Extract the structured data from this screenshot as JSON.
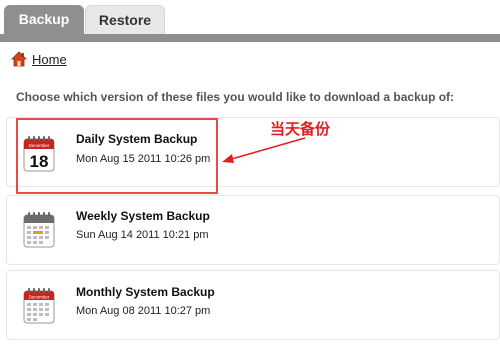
{
  "tabs": [
    {
      "label": "Backup",
      "active": true
    },
    {
      "label": "Restore",
      "active": false
    }
  ],
  "breadcrumb": {
    "home_label": "Home",
    "icon": "home-icon"
  },
  "instruction": "Choose which version of these files you would like to download a backup of:",
  "backups": [
    {
      "title": "Daily System Backup",
      "date": "Mon Aug 15 2011 10:26 pm",
      "icon": "calendar-day-icon",
      "calendar_month": "December",
      "calendar_day": "18"
    },
    {
      "title": "Weekly System Backup",
      "date": "Sun Aug 14 2011 10:21 pm",
      "icon": "calendar-week-icon"
    },
    {
      "title": "Monthly System Backup",
      "date": "Mon Aug 08 2011 10:27 pm",
      "icon": "calendar-month-icon",
      "calendar_month": "December"
    }
  ],
  "annotation": {
    "text": "当天备份",
    "color": "#e02020"
  },
  "colors": {
    "tab_active_bg": "#8f8f8f",
    "tab_inactive_bg": "#e8e8e8",
    "calendar_red": "#c8231f",
    "highlight": "#e84a4a"
  }
}
